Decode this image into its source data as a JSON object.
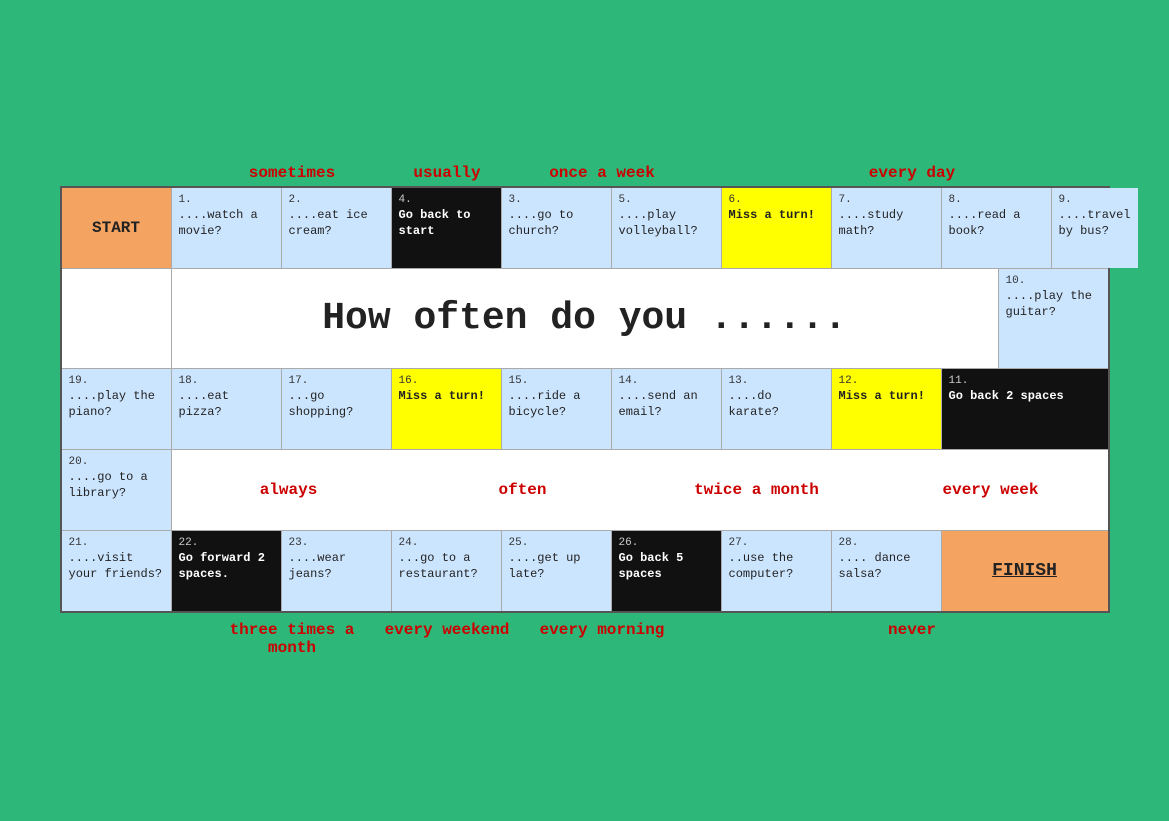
{
  "freq_headers_top": [
    "",
    "sometimes",
    "usually",
    "once a week",
    "",
    "every day"
  ],
  "title": "How often do you ......",
  "freq_headers_mid": [
    "always",
    "often",
    "twice a month",
    "every week"
  ],
  "freq_headers_bottom": [
    "three times a month",
    "every weekend",
    "every morning",
    "never"
  ],
  "cells_row1": [
    {
      "num": "1.",
      "text": "....watch a movie?",
      "style": "light-blue"
    },
    {
      "num": "2.",
      "text": "....eat ice cream?",
      "style": "light-blue"
    },
    {
      "num": "3.",
      "text": "....go to church?",
      "style": "light-blue"
    },
    {
      "num": "4.",
      "text": "Go back to start",
      "style": "black"
    },
    {
      "num": "5.",
      "text": "....play volleyball?",
      "style": "light-blue"
    },
    {
      "num": "6.",
      "text": "Miss a turn!",
      "style": "yellow"
    },
    {
      "num": "7.",
      "text": "....study math?",
      "style": "light-blue"
    },
    {
      "num": "8.",
      "text": "....read a book?",
      "style": "light-blue"
    },
    {
      "num": "9.",
      "text": "....travel by bus?",
      "style": "light-blue"
    }
  ],
  "cell10": {
    "num": "10.",
    "text": "....play the guitar?",
    "style": "light-blue"
  },
  "cells_row3": [
    {
      "num": "19.",
      "text": "....play the piano?",
      "style": "light-blue"
    },
    {
      "num": "18.",
      "text": "....eat pizza?",
      "style": "light-blue"
    },
    {
      "num": "17.",
      "text": "...go shopping?",
      "style": "light-blue"
    },
    {
      "num": "16.",
      "text": "Miss a turn!",
      "style": "yellow"
    },
    {
      "num": "15.",
      "text": "....ride a bicycle?",
      "style": "light-blue"
    },
    {
      "num": "14.",
      "text": "....send an email?",
      "style": "light-blue"
    },
    {
      "num": "13.",
      "text": "....do karate?",
      "style": "light-blue"
    },
    {
      "num": "12.",
      "text": "Miss a turn!",
      "style": "yellow"
    },
    {
      "num": "11.",
      "text": "Go back 2 spaces",
      "style": "black"
    }
  ],
  "cell20": {
    "num": "20.",
    "text": "....go to a library?",
    "style": "light-blue"
  },
  "cells_row5": [
    {
      "num": "21.",
      "text": "....visit your friends?",
      "style": "light-blue"
    },
    {
      "num": "22.",
      "text": "Go forward 2 spaces.",
      "style": "black"
    },
    {
      "num": "23.",
      "text": "....wear jeans?",
      "style": "light-blue"
    },
    {
      "num": "24.",
      "text": "...go to a restaurant?",
      "style": "light-blue"
    },
    {
      "num": "25.",
      "text": "....get up late?",
      "style": "light-blue"
    },
    {
      "num": "26.",
      "text": "Go back 5 spaces",
      "style": "black"
    },
    {
      "num": "27.",
      "text": "..use the computer?",
      "style": "light-blue"
    },
    {
      "num": "28.",
      "text": ".... dance salsa?",
      "style": "light-blue"
    },
    {
      "num": "FINISH",
      "text": "",
      "style": "finish"
    }
  ],
  "start_label": "START"
}
